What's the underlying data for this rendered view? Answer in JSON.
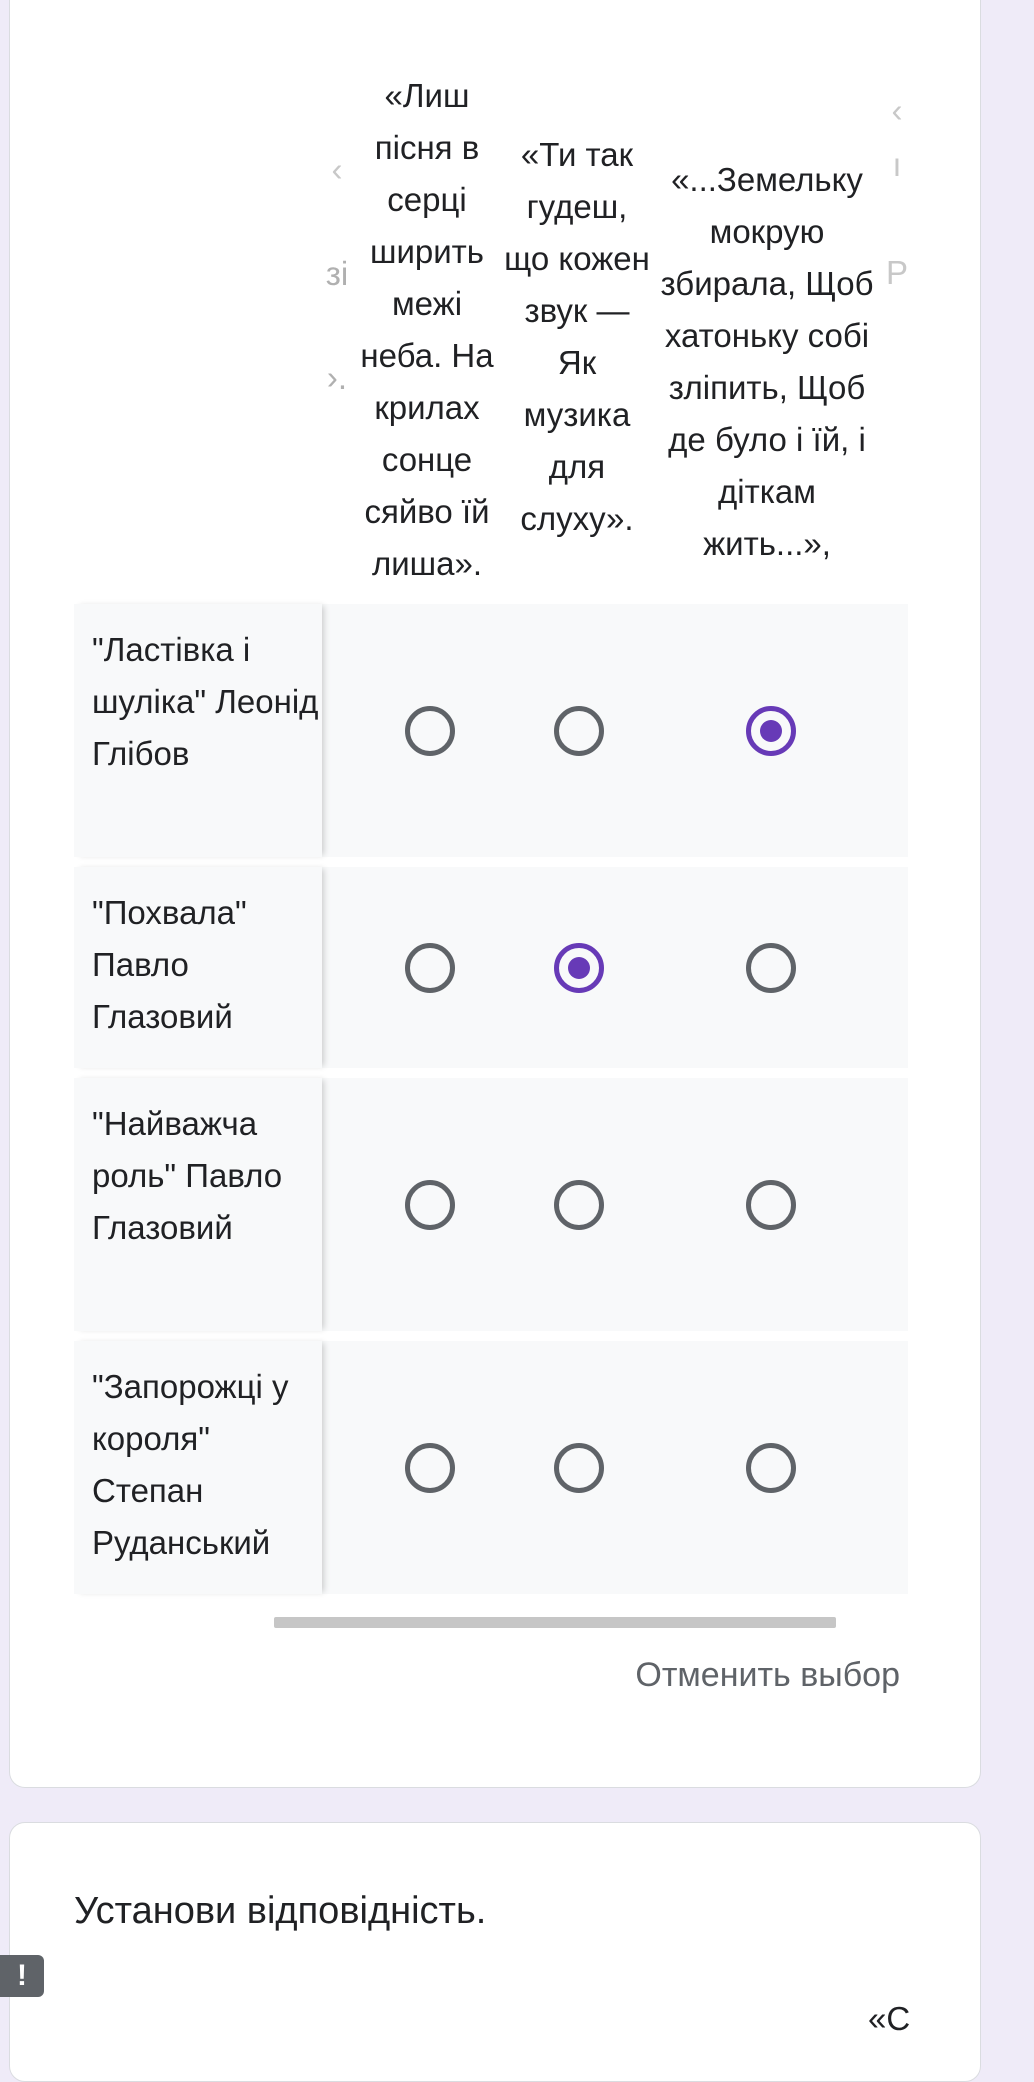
{
  "question": {
    "columns": [
      "«Лиш пісня в серці ширить межі неба. На крилах сонце сяйво їй лиша».",
      "«Ти так гудеш, що кожен звук — Як музика для слуху».",
      "«...Земельку мокрую збирала, Щоб хатоньку собі зліпить, Щоб де було і їй, і діткам жить...»,"
    ],
    "left_partial_column": "« ві ».",
    "right_partial_column": "« і р",
    "rows": [
      {
        "label": "\"Ластівка і шуліка\" Леонід Глібов",
        "selected": 2
      },
      {
        "label": "\"Похвала\" Павло Глазовий",
        "selected": 1
      },
      {
        "label": "\"Найважча роль\" Павло Глазовий",
        "selected": null
      },
      {
        "label": "\"Запорожці у короля\" Степан Руданський",
        "selected": null
      }
    ],
    "clear_label": "Отменить выбор",
    "accent_color": "#673ab7"
  },
  "next_question": {
    "title": "Установи відповідність.",
    "required_marker": "!",
    "partial_header": "«С"
  }
}
